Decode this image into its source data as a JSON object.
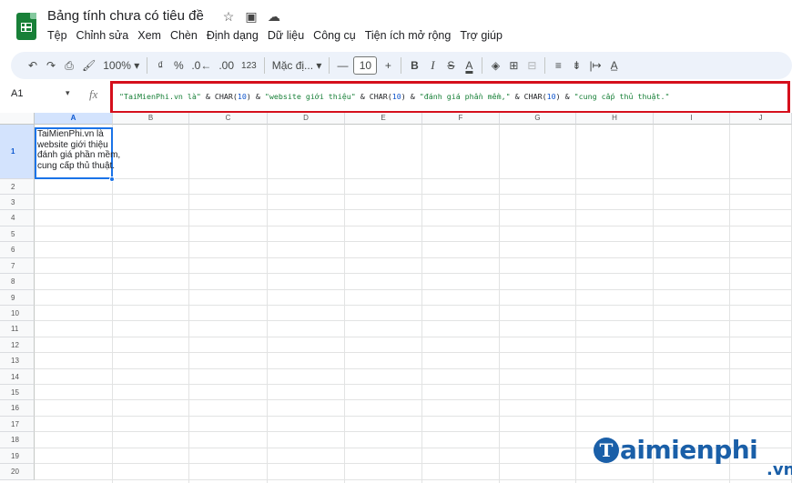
{
  "header": {
    "doc_title": "Bảng tính chưa có tiêu đề",
    "icons": [
      "star-icon",
      "folder-move-icon",
      "cloud-status-icon"
    ]
  },
  "menu": [
    "Tệp",
    "Chỉnh sửa",
    "Xem",
    "Chèn",
    "Định dạng",
    "Dữ liệu",
    "Công cụ",
    "Tiện ích mở rộng",
    "Trợ giúp"
  ],
  "toolbar": {
    "undo": "↶",
    "redo": "↷",
    "print": "⎙",
    "paint_format": "🖌",
    "zoom": "100%",
    "currency": "₫",
    "percent": "%",
    "decrease_decimal": ".0←",
    "increase_decimal": ".00",
    "number_format": "123",
    "font": "Mặc đị...",
    "minus": "—",
    "font_size": "10",
    "plus": "+",
    "bold": "B",
    "italic": "I",
    "strike": "S",
    "text_color": "A",
    "fill_color": "◈",
    "borders": "⊞",
    "merge": "⊟",
    "halign": "≡",
    "valign": "⇟",
    "wrap": "|↦",
    "rotate": "A̲",
    "caret": "▾"
  },
  "formula_bar": {
    "name_box": "A1",
    "fx": "fx",
    "tokens": [
      {
        "t": "str",
        "v": "\"TaiMienPhi.vn là\""
      },
      {
        "t": "op",
        "v": " & CHAR("
      },
      {
        "t": "num",
        "v": "10"
      },
      {
        "t": "op",
        "v": ") & "
      },
      {
        "t": "str",
        "v": "\"website giới thiệu\""
      },
      {
        "t": "op",
        "v": " & CHAR("
      },
      {
        "t": "num",
        "v": "10"
      },
      {
        "t": "op",
        "v": ") & "
      },
      {
        "t": "str",
        "v": "\"đánh giá phần mềm,\""
      },
      {
        "t": "op",
        "v": " & CHAR("
      },
      {
        "t": "num",
        "v": "10"
      },
      {
        "t": "op",
        "v": ") & "
      },
      {
        "t": "str",
        "v": "\"cung cấp thủ thuật.\""
      }
    ]
  },
  "grid": {
    "columns": [
      "A",
      "B",
      "C",
      "D",
      "E",
      "F",
      "G",
      "H",
      "I",
      "J"
    ],
    "rows": [
      "1",
      "2",
      "3",
      "4",
      "5",
      "6",
      "7",
      "8",
      "9",
      "10",
      "11",
      "12",
      "13",
      "14",
      "15",
      "16",
      "17",
      "18",
      "19",
      "20"
    ],
    "selected_column": "A",
    "selected_row": "1",
    "cell_a1": "TaiMienPhi.vn là\nwebsite giới thiệu\nđánh giá phần mềm,\ncung cấp thủ thuật."
  },
  "watermark": {
    "logo_letter": "T",
    "text": "aimienphi",
    "suffix": ".vn"
  },
  "colors": {
    "accent": "#1a73e8",
    "highlight_box": "#d50f1c",
    "sheets_green": "#188038",
    "formula_string": "#188038",
    "formula_number": "#1155cc",
    "watermark": "#1a5fa8"
  }
}
